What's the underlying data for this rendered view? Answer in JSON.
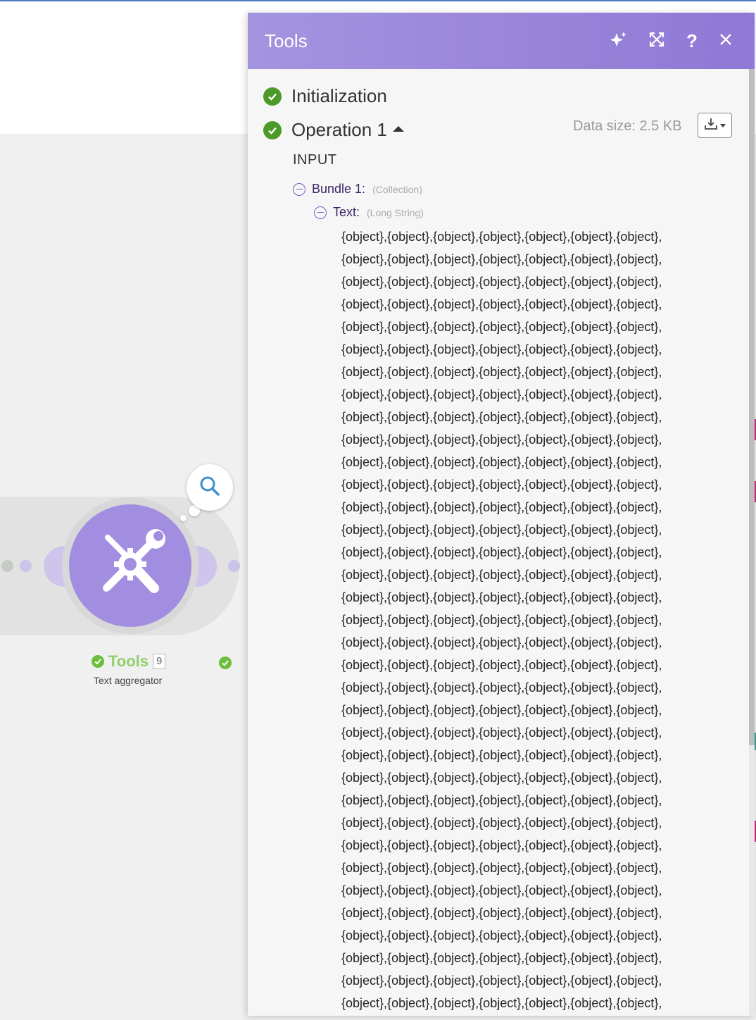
{
  "canvas": {
    "module": {
      "name": "Tools",
      "op_count": "9",
      "subtitle": "Text aggregator",
      "icon": "tools-icon"
    },
    "colors": {
      "module_purple": "#a28ee0",
      "success_green": "#6cbf3c"
    }
  },
  "panel": {
    "title": "Tools",
    "header_buttons": {
      "ai": "sparkles-icon",
      "expand": "expand-icon",
      "help": "?",
      "close": "close-icon"
    },
    "steps": [
      {
        "label": "Initialization",
        "status": "success"
      },
      {
        "label": "Operation 1",
        "status": "success",
        "expanded": true
      }
    ],
    "data_size": "Data size: 2.5 KB",
    "download_icon": "download-icon",
    "input_heading": "INPUT",
    "tree": {
      "bundle": {
        "key": "Bundle 1:",
        "type": "(Collection)"
      },
      "text": {
        "key": "Text:",
        "type": "(Long String)"
      }
    },
    "value_lines": [
      "{object},{object},{object},{object},{object},{object},{object},",
      "{object},{object},{object},{object},{object},{object},{object},",
      "{object},{object},{object},{object},{object},{object},{object},",
      "{object},{object},{object},{object},{object},{object},{object},",
      "{object},{object},{object},{object},{object},{object},{object},",
      "{object},{object},{object},{object},{object},{object},{object},",
      "{object},{object},{object},{object},{object},{object},{object},",
      "{object},{object},{object},{object},{object},{object},{object},",
      "{object},{object},{object},{object},{object},{object},{object},",
      "{object},{object},{object},{object},{object},{object},{object},",
      "{object},{object},{object},{object},{object},{object},{object},",
      "{object},{object},{object},{object},{object},{object},{object},",
      "{object},{object},{object},{object},{object},{object},{object},",
      "{object},{object},{object},{object},{object},{object},{object},",
      "{object},{object},{object},{object},{object},{object},{object},",
      "{object},{object},{object},{object},{object},{object},{object},",
      "{object},{object},{object},{object},{object},{object},{object},",
      "{object},{object},{object},{object},{object},{object},{object},",
      "{object},{object},{object},{object},{object},{object},{object},",
      "{object},{object},{object},{object},{object},{object},{object},",
      "{object},{object},{object},{object},{object},{object},{object},",
      "{object},{object},{object},{object},{object},{object},{object},",
      "{object},{object},{object},{object},{object},{object},{object},",
      "{object},{object},{object},{object},{object},{object},{object},",
      "{object},{object},{object},{object},{object},{object},{object},",
      "{object},{object},{object},{object},{object},{object},{object},",
      "{object},{object},{object},{object},{object},{object},{object},",
      "{object},{object},{object},{object},{object},{object},{object},",
      "{object},{object},{object},{object},{object},{object},{object},",
      "{object},{object},{object},{object},{object},{object},{object},",
      "{object},{object},{object},{object},{object},{object},{object},",
      "{object},{object},{object},{object},{object},{object},{object},",
      "{object},{object},{object},{object},{object},{object},{object},",
      "{object},{object},{object},{object},{object},{object},{object},",
      "{object},{object},{object},{object},{object},{object},{object},"
    ],
    "colors": {
      "header_start": "#a494df",
      "header_end": "#8f78d6",
      "step_check": "#4d9a29",
      "tree_accent": "#7a5cc6"
    }
  }
}
